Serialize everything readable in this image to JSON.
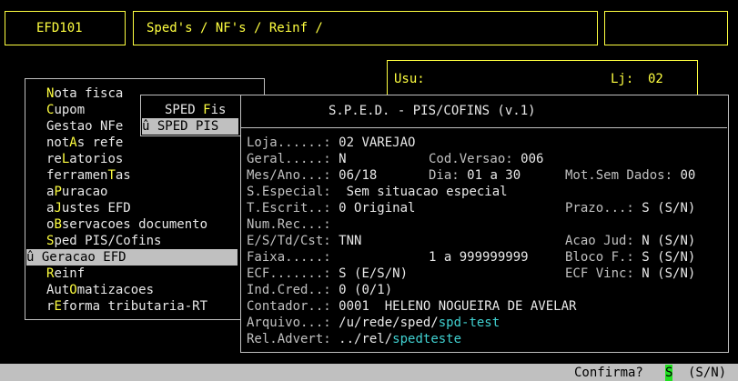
{
  "header": {
    "program_code": "EFD101",
    "breadcrumb": "Sped's / NF's / Reinf /",
    "user_label": "Usu:",
    "store_label": "Lj:",
    "store_value": "02"
  },
  "main_menu": {
    "items": [
      {
        "hot": "N",
        "rest": "ota fisca"
      },
      {
        "hot": "C",
        "rest": "upom"
      },
      {
        "pre": "Gestao NFe",
        "hot": "",
        "rest": ""
      },
      {
        "pre": "not",
        "hot": "A",
        "rest": "s refe"
      },
      {
        "pre": "re",
        "hot": "L",
        "rest": "atorios"
      },
      {
        "pre": "ferramen",
        "hot": "T",
        "rest": "as"
      },
      {
        "pre": "a",
        "hot": "P",
        "rest": "uracao"
      },
      {
        "pre": "a",
        "hot": "J",
        "rest": "ustes EFD"
      },
      {
        "pre": "o",
        "hot": "B",
        "rest": "servacoes documento"
      },
      {
        "hot": "S",
        "rest": "ped PIS/Cofins"
      },
      {
        "pre": "û Geracao EFD",
        "selected": true
      },
      {
        "hot": "R",
        "rest": "einf"
      },
      {
        "pre": "Aut",
        "hot": "O",
        "rest": "matizacoes"
      },
      {
        "pre": "r",
        "hot": "E",
        "rest": "forma tributaria-RT"
      }
    ]
  },
  "submenu": {
    "item1_pre": "SPED ",
    "item1_hot": "F",
    "item1_rest": "is",
    "item2": "û SPED PIS"
  },
  "dialog": {
    "title": "S.P.E.D. - PIS/COFINS (v.1)",
    "rows": {
      "loja": {
        "label": "Loja......:",
        "value": "02 VAREJAO"
      },
      "geral": {
        "label": "Geral.....:",
        "value": "N",
        "label2": "Cod.Versao:",
        "value2": "006"
      },
      "mesano": {
        "label": "Mes/Ano...:",
        "value": "06/18",
        "label2": "Dia:",
        "value2": "01 a 30",
        "label3": "Mot.Sem Dados:",
        "value3": "00"
      },
      "sespecial": {
        "label": "S.Especial:",
        "value": "Sem situacao especial"
      },
      "tescrit": {
        "label": "T.Escrit..:",
        "value": "0 Original",
        "label2": "Prazo...:",
        "value2": "S (S/N)"
      },
      "numrec": {
        "label": "Num.Rec...:",
        "value": ""
      },
      "estd": {
        "label": "E/S/Td/Cst:",
        "value": "TNN",
        "label2": "Acao Jud:",
        "value2": "N (S/N)"
      },
      "faixa": {
        "label": "Faixa.....:",
        "value": "1 a 999999999",
        "label2": "Bloco F.:",
        "value2": "S (S/N)"
      },
      "ecf": {
        "label": "ECF.......:",
        "value": "S (E/S/N)",
        "label2": "ECF Vinc:",
        "value2": "N (S/N)"
      },
      "indcred": {
        "label": "Ind.Cred..:",
        "value": "0 (0/1)"
      },
      "contador": {
        "label": "Contador..:",
        "value": "0001  HELENO NOGUEIRA DE AVELAR"
      },
      "arquivo": {
        "label": "Arquivo...:",
        "value_path": "/u/rede/sped/",
        "value_file": "spd-test"
      },
      "reladvert": {
        "label": "Rel.Advert:",
        "value_path": "../rel/",
        "value_file": "spedteste"
      }
    }
  },
  "status_bar": {
    "prompt": "Confirma?",
    "value": "S",
    "options": "(S/N)"
  }
}
